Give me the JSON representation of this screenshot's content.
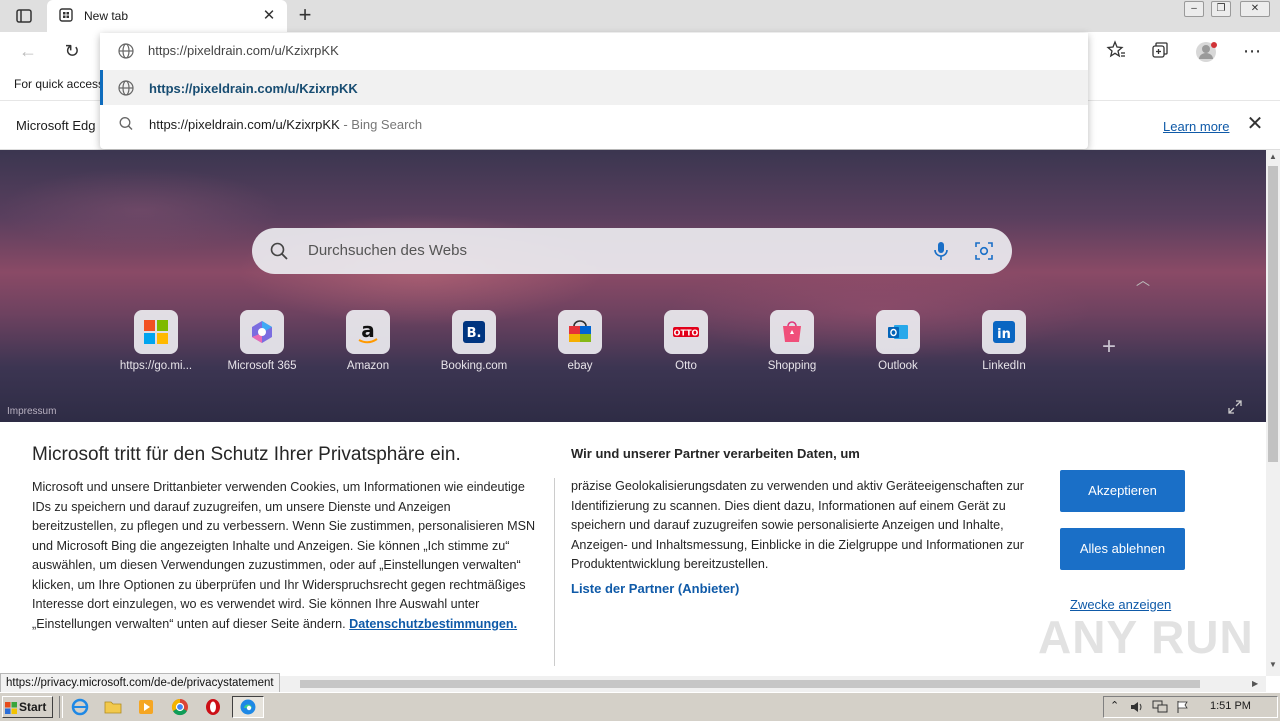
{
  "tab": {
    "title": "New tab"
  },
  "omnibox": {
    "input_value": "https://pixeldrain.com/u/KzixrpKK",
    "suggestions": [
      {
        "text": "https://pixeldrain.com/u/KzixrpKK",
        "suffix": ""
      },
      {
        "text": "https://pixeldrain.com/u/KzixrpKK",
        "suffix": " - Bing Search"
      }
    ]
  },
  "favorites_bar": {
    "text": "For quick access"
  },
  "infobar": {
    "text": "Microsoft Edg",
    "learn_more": "Learn more"
  },
  "ntp": {
    "search_placeholder": "Durchsuchen des Webs",
    "tiles": [
      {
        "label": "https://go.mi...",
        "icon": "microsoft-logo-icon"
      },
      {
        "label": "Microsoft 365",
        "icon": "microsoft-365-icon"
      },
      {
        "label": "Amazon",
        "icon": "amazon-icon"
      },
      {
        "label": "Booking.com",
        "icon": "booking-icon"
      },
      {
        "label": "ebay",
        "icon": "ebay-icon"
      },
      {
        "label": "Otto",
        "icon": "otto-icon"
      },
      {
        "label": "Shopping",
        "icon": "shopping-icon"
      },
      {
        "label": "Outlook",
        "icon": "outlook-icon"
      },
      {
        "label": "LinkedIn",
        "icon": "linkedin-icon"
      }
    ],
    "impressum": "Impressum"
  },
  "consent": {
    "title": "Microsoft tritt für den Schutz Ihrer Privatsphäre ein.",
    "body": "Microsoft und unsere Drittanbieter verwenden Cookies, um Informationen wie eindeutige IDs zu speichern und darauf zuzugreifen, um unsere Dienste und Anzeigen bereitzustellen, zu pflegen und zu verbessern. Wenn Sie zustimmen, personalisieren MSN und Microsoft Bing die angezeigten Inhalte und Anzeigen. Sie können „Ich stimme zu“ auswählen, um diesen Verwendungen zuzustimmen, oder auf „Einstellungen verwalten“ klicken, um Ihre Optionen zu überprüfen und Ihr Widerspruchsrecht gegen rechtmäßiges Interesse dort einzulegen, wo es verwendet wird.  Sie können Ihre Auswahl unter „Einstellungen verwalten“ unten auf dieser Seite ändern.",
    "privacy_link": "Datenschutzbestimmungen.",
    "partner_title": "Wir und unserer Partner verarbeiten Daten, um",
    "partner_body": "präzise Geolokalisierungsdaten zu verwenden und aktiv Geräteeigenschaften zur Identifizierung zu scannen. Dies dient dazu, Informationen auf einem Gerät zu speichern und darauf zuzugreifen sowie personalisierte Anzeigen und Inhalte, Anzeigen- und Inhaltsmessung, Einblicke in die Zielgruppe und Informationen zur Produktentwicklung bereitzustellen.",
    "partner_list_link": "Liste der Partner (Anbieter)",
    "accept_label": "Akzeptieren",
    "reject_label": "Alles ablehnen",
    "purposes_link": "Zwecke anzeigen"
  },
  "watermark": "ANY RUN",
  "statusbar": {
    "url": "https://privacy.microsoft.com/de-de/privacystatement"
  },
  "taskbar": {
    "start_label": "Start",
    "clock": "1:51 PM"
  },
  "colors": {
    "accent": "#1a6fc7",
    "link": "#0f5aa8"
  }
}
